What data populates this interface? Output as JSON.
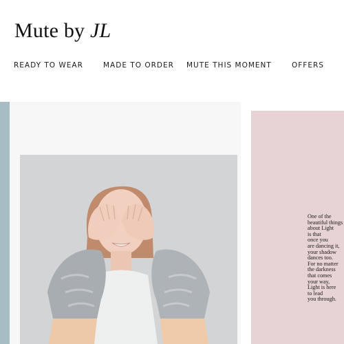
{
  "header": {
    "logo_text": "Mute by ",
    "logo_italic": "JL"
  },
  "nav": {
    "items": [
      {
        "label": "READY TO WEAR"
      },
      {
        "label": "MADE TO ORDER"
      },
      {
        "label": "MUTE THIS MOMENT"
      },
      {
        "label": "OFFERS"
      }
    ]
  },
  "main": {
    "photo_alt": "Model covering her eyes wearing a grey and peach fur jacket",
    "quote_lines": [
      "One of the",
      "beautiful things",
      "about Light",
      "is that",
      "once you",
      "are dancing it,",
      "your shadow",
      "dances too.",
      "For no matter",
      "the darkness",
      "that comes",
      "your way,",
      "Light is here",
      "to lead",
      "you through."
    ]
  },
  "colors": {
    "blue_strip": "#a7bdc5",
    "pink_panel": "#e7d3d5",
    "photo_bg": "#d4d5d6",
    "text": "#111111"
  }
}
